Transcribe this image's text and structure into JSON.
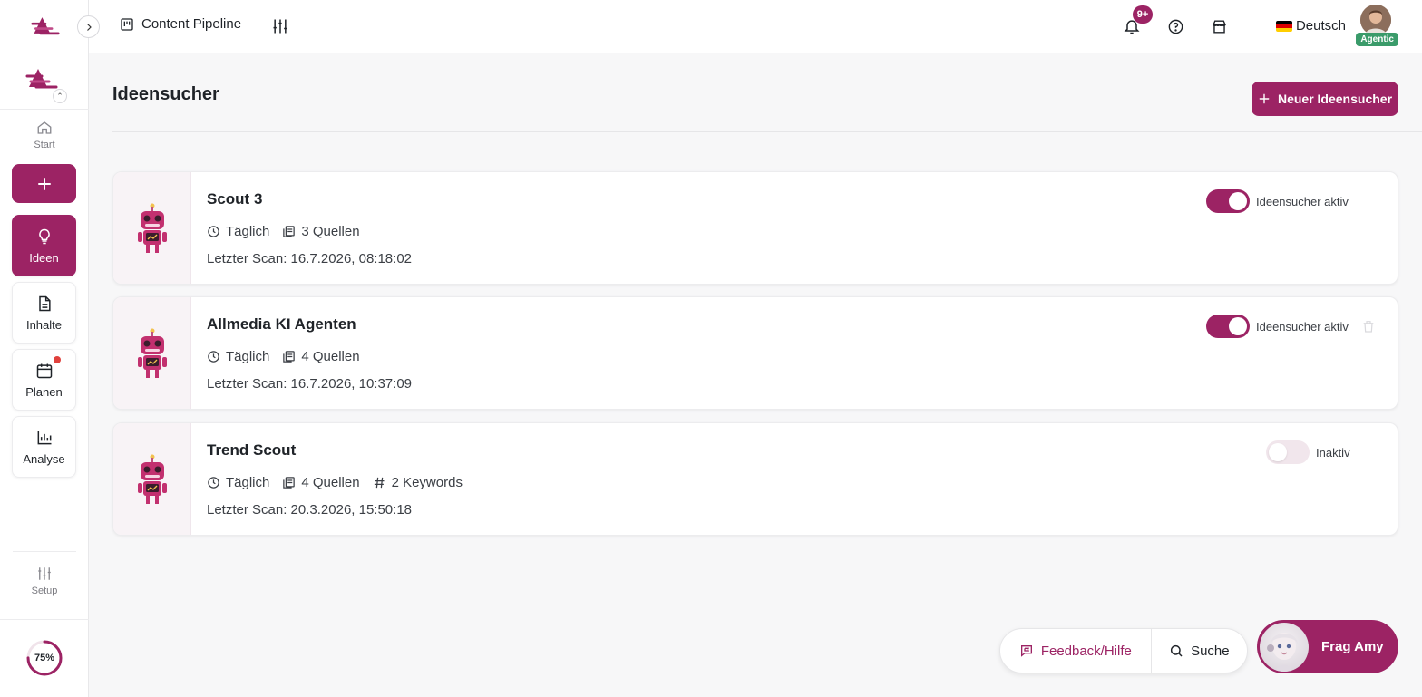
{
  "colors": {
    "brand": "#9c2364",
    "brand_light": "#f8f3f6",
    "success": "#3a9b6a",
    "alert": "#e0413d"
  },
  "topbar": {
    "pipeline_label": "Content Pipeline",
    "notification_count": "9+",
    "language": "Deutsch",
    "user_badge": "Agentic"
  },
  "sidebar": {
    "start_label": "Start",
    "nav": [
      {
        "label": "Ideen",
        "icon": "lightbulb-icon",
        "active": true
      },
      {
        "label": "Inhalte",
        "icon": "document-icon",
        "active": false
      },
      {
        "label": "Planen",
        "icon": "calendar-icon",
        "active": false
      },
      {
        "label": "Analyse",
        "icon": "bar-chart-icon",
        "active": false
      }
    ],
    "setup_label": "Setup",
    "progress_label": "75%",
    "progress_value": 0.75
  },
  "main": {
    "title": "Ideensucher",
    "new_button_label": "Neuer Ideensucher",
    "scouts": [
      {
        "name": "Scout 3",
        "frequency": "Täglich",
        "sources": "3 Quellen",
        "keywords": "",
        "last_scan": "Letzter Scan: 16.7.2026, 08:18:02",
        "status": "Ideensucher aktiv",
        "active": true
      },
      {
        "name": "Allmedia KI Agenten",
        "frequency": "Täglich",
        "sources": "4 Quellen",
        "keywords": "",
        "last_scan": "Letzter Scan: 16.7.2026, 10:37:09",
        "status": "Ideensucher aktiv",
        "active": true
      },
      {
        "name": "Trend Scout",
        "frequency": "Täglich",
        "sources": "4 Quellen",
        "keywords": "2 Keywords",
        "last_scan": "Letzter Scan: 20.3.2026, 15:50:18",
        "status": "Inaktiv",
        "active": false
      }
    ]
  },
  "floating": {
    "feedback_label": "Feedback/Hilfe",
    "search_label": "Suche",
    "amy_label": "Frag Amy"
  }
}
